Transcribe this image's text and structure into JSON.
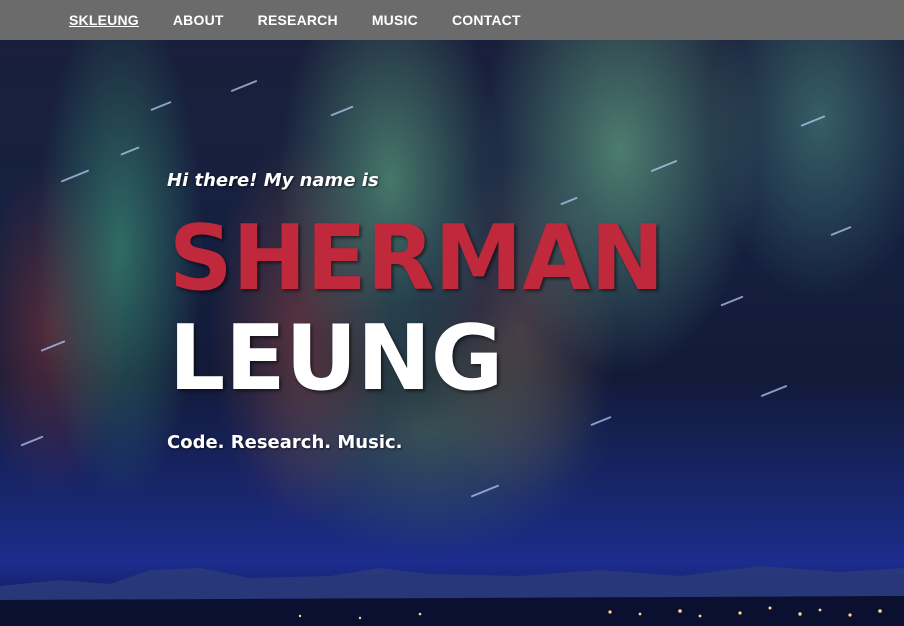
{
  "nav": {
    "items": [
      {
        "label": "SKLEUNG",
        "active": true
      },
      {
        "label": "ABOUT",
        "active": false
      },
      {
        "label": "RESEARCH",
        "active": false
      },
      {
        "label": "MUSIC",
        "active": false
      },
      {
        "label": "CONTACT",
        "active": false
      }
    ]
  },
  "hero": {
    "greeting": "Hi there! My name is",
    "first_name": "SHERMAN",
    "last_name": "LEUNG",
    "tagline": "Code. Research. Music."
  },
  "colors": {
    "nav_background": "#6b6b6b",
    "first_name": "#c0283c",
    "text": "#ffffff"
  }
}
